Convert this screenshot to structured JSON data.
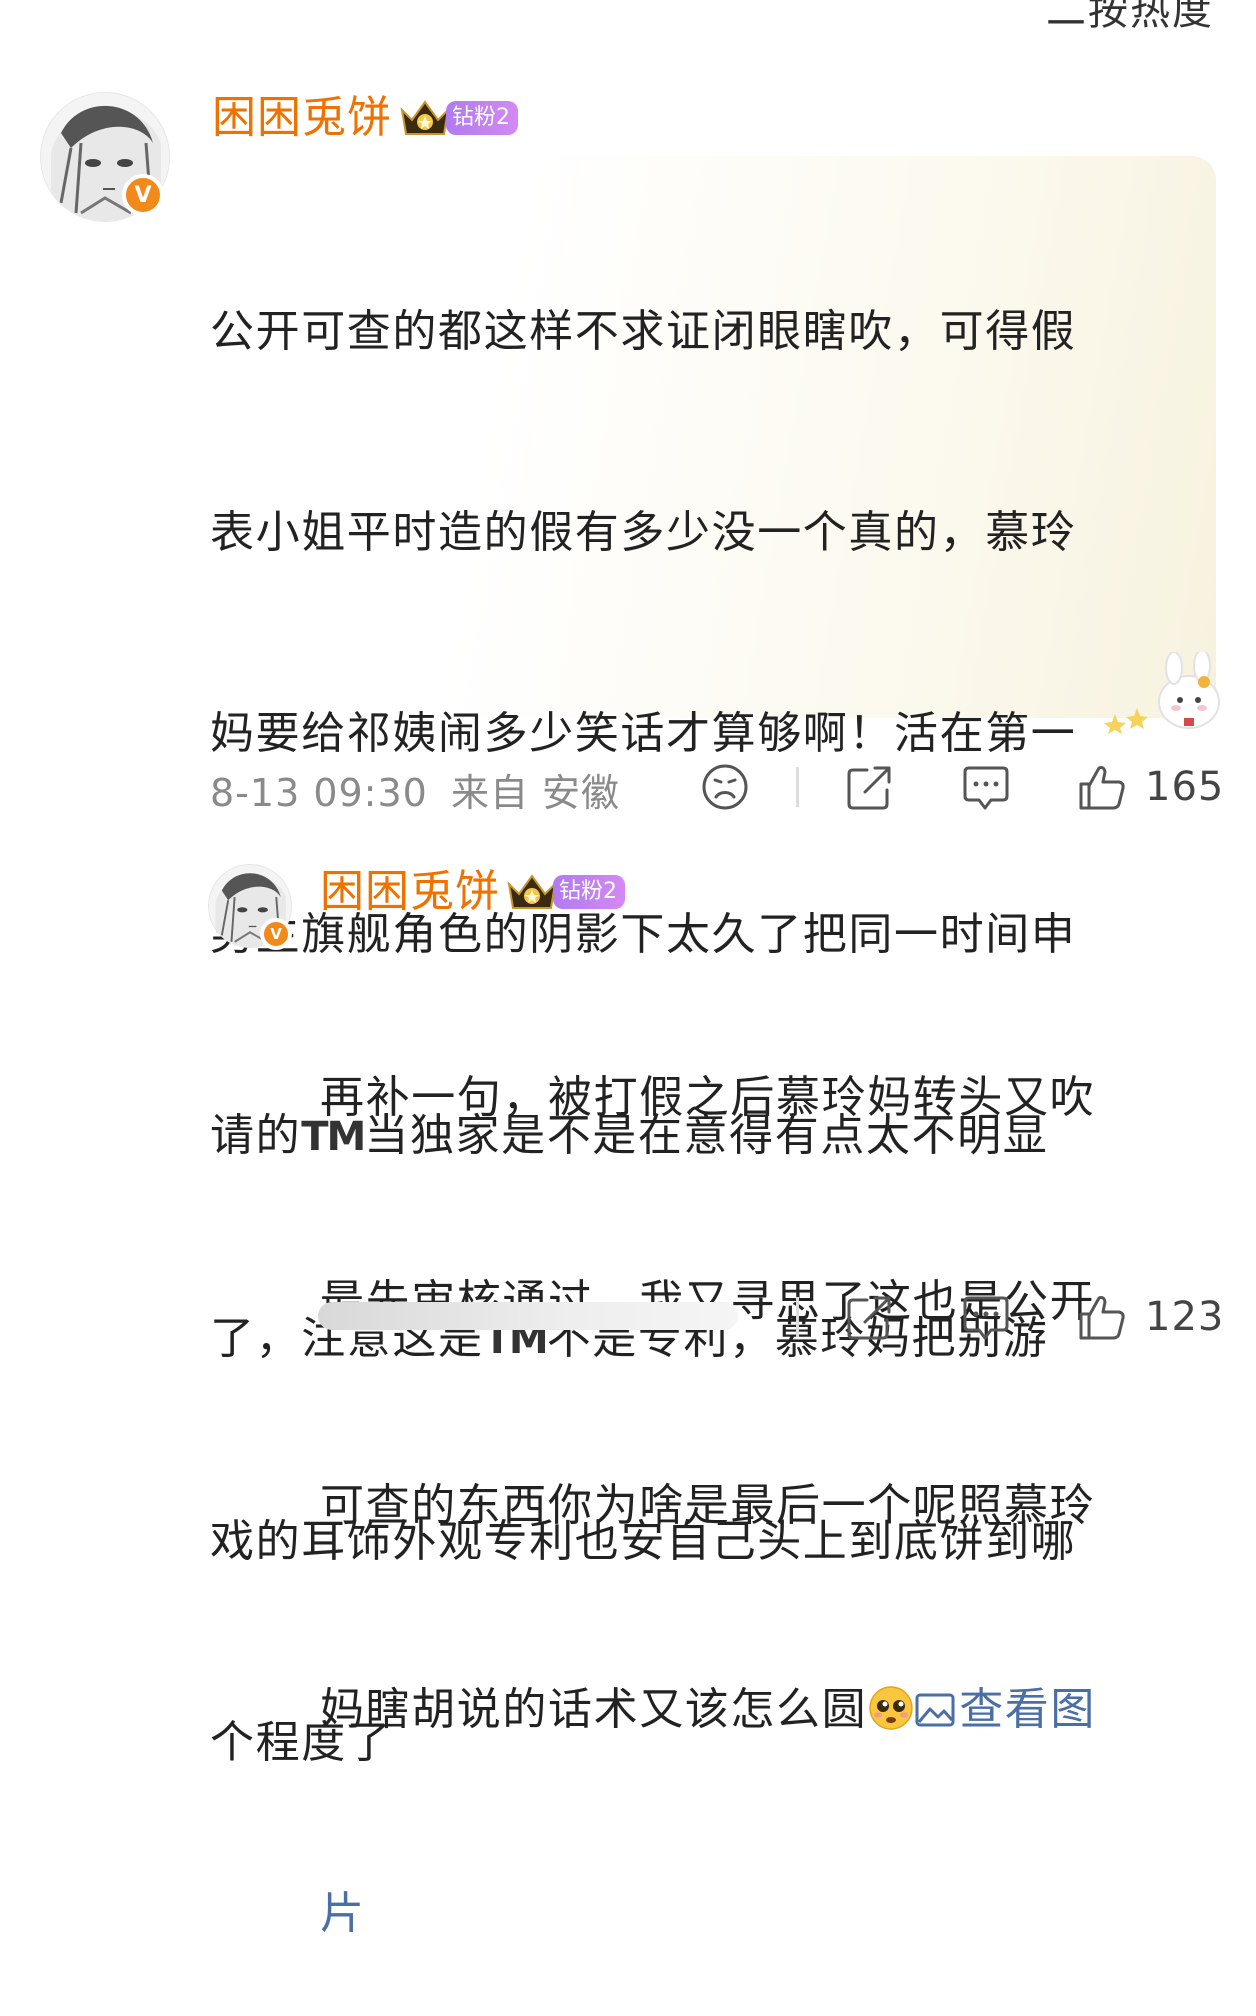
{
  "header": {
    "sort_label": "二按热度"
  },
  "comment": {
    "username": "困困兎饼",
    "badge": "钻粉2",
    "verified_glyph": "V",
    "content_lines": [
      "公开可查的都这样不求证闭眼瞎吹，可得假",
      "表小姐平时造的假有多少没一个真的，慕玲",
      "妈要给祁姨闹多少笑话才算够啊！活在第一",
      "男主旗舰角色的阴影下太久了把同一时间申"
    ],
    "line5_before": "请的",
    "line5_tm": "TM",
    "line5_after": "当独家是不是在意得有点太不明显",
    "line6_before": "了，注意这是",
    "line6_tm": "TM",
    "line6_after": "不是专利，慕玲妈把别游",
    "line7": "戏的耳饰外观专利也安自己头上到底饼到哪",
    "line8": "个程度了",
    "timestamp": "8-13 09:30",
    "location": "来自 安徽",
    "like_count": "165"
  },
  "reply": {
    "username": "困困兎饼",
    "badge": "钻粉2",
    "verified_glyph": "V",
    "content_lines": [
      "再补一句，被打假之后慕玲妈转头又吹",
      "最先审核通过，我又寻思了这也是公开",
      "可查的东西你为啥是最后一个呢照慕玲"
    ],
    "line4": "妈瞎胡说的话术又该怎么圆",
    "view_image_link_a": "查看图",
    "view_image_link_b": "片",
    "like_count": "123"
  },
  "icons": {
    "dislike": "sad-face-icon",
    "share": "share-icon",
    "comment": "comment-icon",
    "like": "thumbs-up-icon",
    "image": "image-icon",
    "emoji": "pleading-face-emoji",
    "crown": "crown-icon"
  },
  "colors": {
    "username": "#ef7100",
    "badge": "#c283f2",
    "verified": "#f28a1a",
    "link": "#4a6fa5",
    "meta": "#8a8a8a"
  }
}
